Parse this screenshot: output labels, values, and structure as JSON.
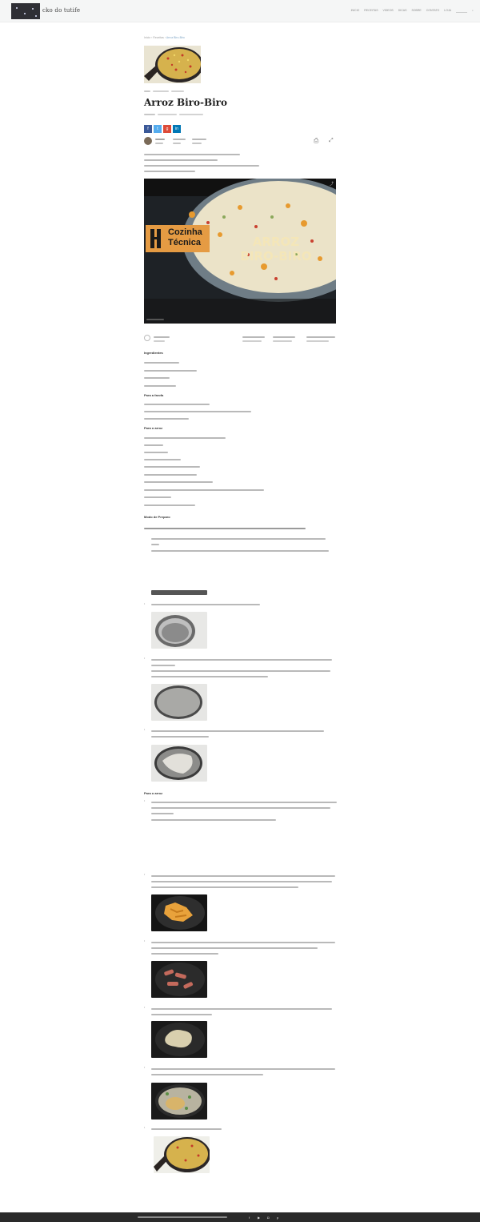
{
  "header": {
    "logo_text": "cko do tutife",
    "nav": [
      "INICIO",
      "RECEITAS",
      "VIDEOS",
      "DICAS",
      "SOBRE",
      "CONTATO",
      "LOJA"
    ]
  },
  "article": {
    "breadcrumb_home": "Inicio",
    "breadcrumb_section": "Receitas",
    "breadcrumb_current": "Arroz Biro-Biro",
    "title": "Arroz Biro-Biro",
    "video": {
      "brand_line1": "Cozinha",
      "brand_line2": "Técnica",
      "overlay_line1": "ARROZ",
      "overlay_line2": "BIRO-BIRO"
    },
    "sections": {
      "ingredients": "Ingredientes",
      "preparation": "Modo de Preparo",
      "sub_a": "Para a farofa",
      "sub_b": "Para o arroz"
    }
  },
  "colors": {
    "share": [
      "#3b5998",
      "#55acee",
      "#dd4b39",
      "#0077b5"
    ],
    "video_accent": "#e59b43"
  },
  "icons": [
    "facebook-icon",
    "twitter-icon",
    "google-plus-icon",
    "linkedin-icon",
    "print-icon",
    "expand-icon"
  ]
}
